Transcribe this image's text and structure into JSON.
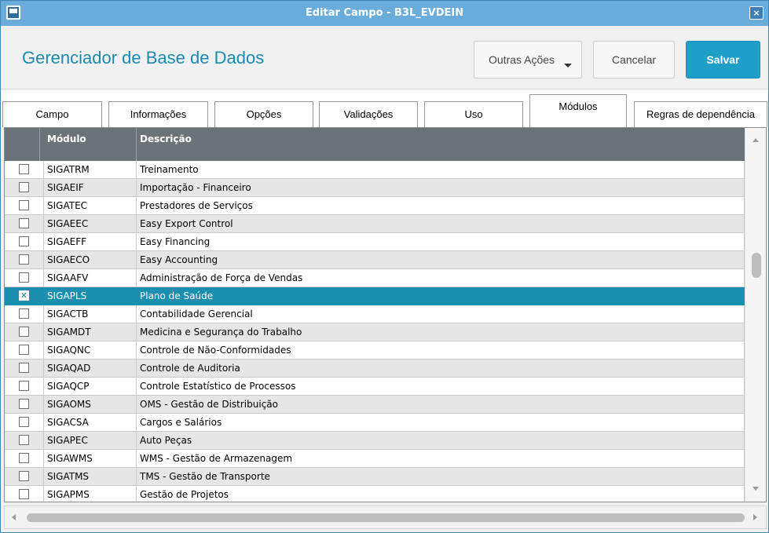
{
  "window": {
    "title": "Editar Campo - B3L_EVDEIN",
    "close_glyph": "×"
  },
  "header": {
    "app_title": "Gerenciador de Base de Dados",
    "buttons": {
      "more_actions": "Outras Ações",
      "cancel": "Cancelar",
      "save": "Salvar"
    }
  },
  "tabs": [
    {
      "label": "Campo",
      "active": false
    },
    {
      "label": "Informações",
      "active": false
    },
    {
      "label": "Opções",
      "active": false
    },
    {
      "label": "Validações",
      "active": false
    },
    {
      "label": "Uso",
      "active": false
    },
    {
      "label": "Módulos",
      "active": true
    },
    {
      "label": "Regras de dependência",
      "active": false
    }
  ],
  "grid": {
    "columns": {
      "module": "Módulo",
      "description": "Descrição"
    },
    "rows": [
      {
        "module": "SIGATRM",
        "description": "Treinamento",
        "checked": false
      },
      {
        "module": "SIGAEIF",
        "description": "Importação - Financeiro",
        "checked": false
      },
      {
        "module": "SIGATEC",
        "description": "Prestadores de Serviços",
        "checked": false
      },
      {
        "module": "SIGAEEC",
        "description": "Easy Export Control",
        "checked": false
      },
      {
        "module": "SIGAEFF",
        "description": "Easy Financing",
        "checked": false
      },
      {
        "module": "SIGAECO",
        "description": "Easy Accounting",
        "checked": false
      },
      {
        "module": "SIGAAFV",
        "description": "Administração de Força de Vendas",
        "checked": false
      },
      {
        "module": "SIGAPLS",
        "description": "Plano de Saúde",
        "checked": true,
        "selected": true
      },
      {
        "module": "SIGACTB",
        "description": "Contabilidade Gerencial",
        "checked": false
      },
      {
        "module": "SIGAMDT",
        "description": "Medicina e Segurança do Trabalho",
        "checked": false
      },
      {
        "module": "SIGAQNC",
        "description": "Controle de Não-Conformidades",
        "checked": false
      },
      {
        "module": "SIGAQAD",
        "description": "Controle de Auditoria",
        "checked": false
      },
      {
        "module": "SIGAQCP",
        "description": "Controle Estatístico de Processos",
        "checked": false
      },
      {
        "module": "SIGAOMS",
        "description": "OMS - Gestão de Distribuição",
        "checked": false
      },
      {
        "module": "SIGACSA",
        "description": "Cargos e Salários",
        "checked": false
      },
      {
        "module": "SIGAPEC",
        "description": "Auto Peças",
        "checked": false
      },
      {
        "module": "SIGAWMS",
        "description": "WMS - Gestão de Armazenagem",
        "checked": false
      },
      {
        "module": "SIGATMS",
        "description": "TMS - Gestão de Transporte",
        "checked": false
      },
      {
        "module": "SIGAPMS",
        "description": "Gestão de Projetos",
        "checked": false
      }
    ]
  },
  "colors": {
    "accent": "#1f9ec7",
    "selected_row": "#1a8fb0",
    "title_bar": "#6aaddb",
    "grid_header": "#6c7378"
  }
}
